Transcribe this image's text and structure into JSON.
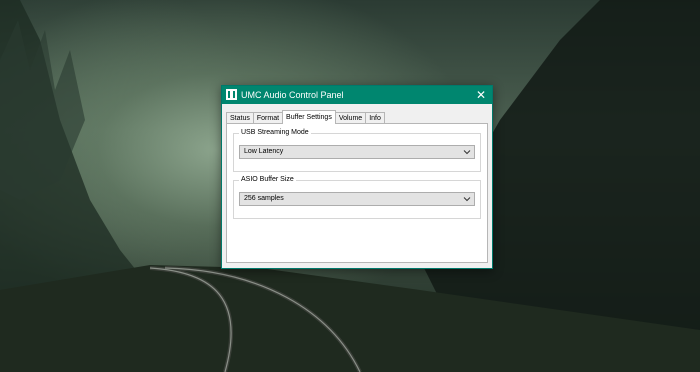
{
  "window": {
    "title": "UMC Audio Control Panel",
    "close_symbol": "✕",
    "accent_color": "#00866f",
    "icon": "umc-app-icon"
  },
  "tabs": [
    {
      "label": "Status",
      "active": false
    },
    {
      "label": "Format",
      "active": false
    },
    {
      "label": "Buffer Settings",
      "active": true
    },
    {
      "label": "Volume",
      "active": false
    },
    {
      "label": "Info",
      "active": false
    }
  ],
  "usb_streaming_mode": {
    "label": "USB Streaming Mode",
    "selected": "Low Latency"
  },
  "asio_buffer_size": {
    "label": "ASIO Buffer Size",
    "selected": "256 samples"
  }
}
